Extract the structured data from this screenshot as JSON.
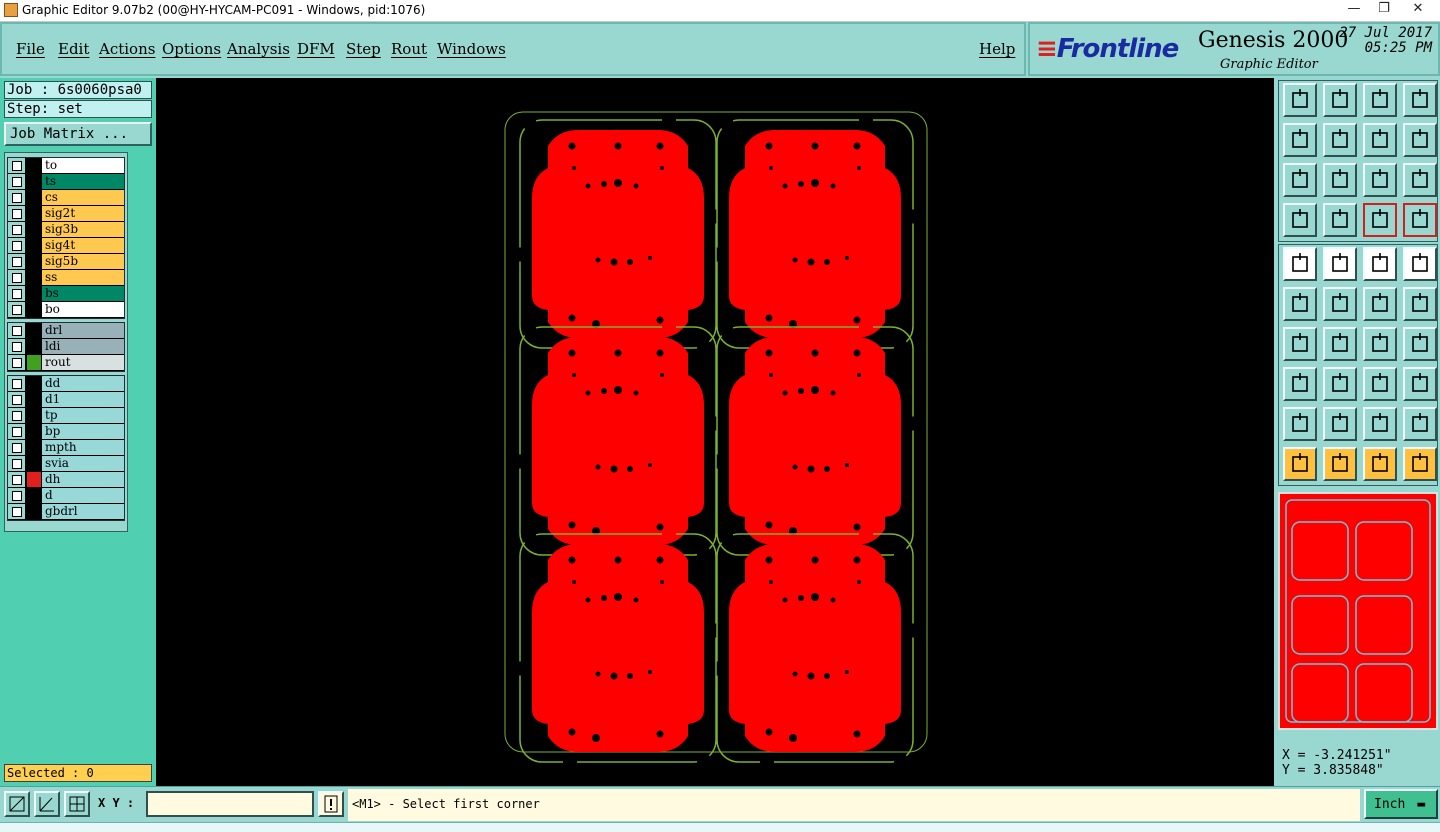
{
  "window": {
    "title": "Graphic Editor 9.07b2 (00@HY-HYCAM-PC091 - Windows, pid:1076)",
    "controls": [
      "—",
      "❐",
      "✕"
    ]
  },
  "menu": [
    "File",
    "Edit",
    "Actions",
    "Options",
    "Analysis",
    "DFM",
    "Step",
    "Rout",
    "Windows"
  ],
  "help_label": "Help",
  "brand": {
    "logo": "Frontline",
    "product": "Genesis 2000",
    "subtitle": "Graphic Editor",
    "date": "27 Jul 2017",
    "time": "05:25 PM"
  },
  "job": {
    "job_text": "Job : 6s0060psa0",
    "step_text": "Step: set",
    "matrix_button": "Job Matrix ..."
  },
  "layer_groups": [
    [
      {
        "name": "to",
        "color": "#ffffff",
        "swatch": "#000000"
      },
      {
        "name": "ts",
        "color": "#008866",
        "swatch": "#000000"
      },
      {
        "name": "cs",
        "color": "#ffc850",
        "swatch": "#000000"
      },
      {
        "name": "sig2t",
        "color": "#ffc850",
        "swatch": "#000000"
      },
      {
        "name": "sig3b",
        "color": "#ffc850",
        "swatch": "#000000"
      },
      {
        "name": "sig4t",
        "color": "#ffc850",
        "swatch": "#000000"
      },
      {
        "name": "sig5b",
        "color": "#ffc850",
        "swatch": "#000000"
      },
      {
        "name": "ss",
        "color": "#ffc850",
        "swatch": "#000000"
      },
      {
        "name": "bs",
        "color": "#008866",
        "swatch": "#000000"
      },
      {
        "name": "bo",
        "color": "#ffffff",
        "swatch": "#000000"
      }
    ],
    [
      {
        "name": "drl",
        "color": "#98b0b8",
        "swatch": "#000000"
      },
      {
        "name": "ldi",
        "color": "#98b0b8",
        "swatch": "#000000"
      },
      {
        "name": "rout",
        "color": "#d8e0e0",
        "swatch": "#40a020"
      }
    ],
    [
      {
        "name": "dd",
        "color": "#98d8d8",
        "swatch": "#000000"
      },
      {
        "name": "d1",
        "color": "#98d8d8",
        "swatch": "#000000"
      },
      {
        "name": "tp",
        "color": "#98d8d8",
        "swatch": "#000000"
      },
      {
        "name": "bp",
        "color": "#98d8d8",
        "swatch": "#000000"
      },
      {
        "name": "mpth",
        "color": "#98d8d8",
        "swatch": "#000000"
      },
      {
        "name": "svia",
        "color": "#98d8d8",
        "swatch": "#000000"
      },
      {
        "name": "dh",
        "color": "#98d8d8",
        "swatch": "#e02020"
      },
      {
        "name": "d",
        "color": "#98d8d8",
        "swatch": "#000000"
      },
      {
        "name": "gbdrl",
        "color": "#98d8d8",
        "swatch": "#000000"
      }
    ]
  ],
  "selected_text": "Selected : 0",
  "coordinates": {
    "x_text": "X = -3.241251\"",
    "y_text": "Y = 3.835848\""
  },
  "status": {
    "xy_label": "X Y :",
    "xy_value": "",
    "prompt": "<M1> - Select first corner",
    "unit": "Inch"
  },
  "toolbar_top": [
    "home-icon",
    "down-icon",
    "house-icon",
    "window-icon",
    "left-icon",
    "right-icon",
    "undo-icon",
    "s-icon",
    "zoom-fit-icon",
    "zoom-center-icon",
    "one-to-two-icon",
    "help-icon",
    "tools-icon",
    "grid-icon",
    "layers-icon",
    "layers-red-icon"
  ],
  "toolbar_bottom": [
    "pad-icon",
    "shape-icon",
    "ruler-icon",
    "dot-icon",
    "node-icon",
    "cross-icon",
    "arrow-icon",
    "arrow-blue-icon",
    "angle-icon",
    "line-icon",
    "rotate-icon",
    "mirror-icon",
    "move-icon",
    "line2-icon",
    "resize-icon",
    "blob-icon",
    "tri-icon",
    "tri2-icon",
    "tri3-icon",
    "tri4-icon",
    "pointer-icon",
    "pointer-box-icon",
    "pointer-circle-icon",
    "route-icon"
  ],
  "colors": {
    "board": "#ff0000",
    "outline": "#7ab030",
    "canvas": "#000000"
  }
}
